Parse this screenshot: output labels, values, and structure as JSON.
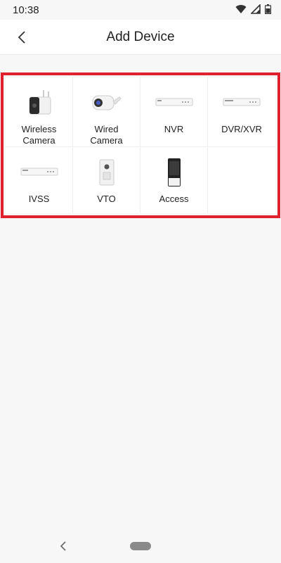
{
  "status_bar": {
    "time": "10:38",
    "icons": [
      "wifi-icon",
      "signal-icon",
      "battery-icon"
    ]
  },
  "header": {
    "title": "Add Device",
    "back_icon": "back-arrow-icon"
  },
  "device_grid": {
    "items": [
      {
        "label": "Wireless Camera",
        "icon": "wireless-camera-icon"
      },
      {
        "label": "Wired Camera",
        "icon": "wired-camera-icon"
      },
      {
        "label": "NVR",
        "icon": "nvr-icon"
      },
      {
        "label": "DVR/XVR",
        "icon": "dvr-icon"
      },
      {
        "label": "IVSS",
        "icon": "ivss-icon"
      },
      {
        "label": "VTO",
        "icon": "vto-icon"
      },
      {
        "label": "Access",
        "icon": "access-icon"
      }
    ]
  },
  "colors": {
    "highlight": "#e0202c",
    "background": "#f7f7f7",
    "tile_background": "#ffffff"
  },
  "nav_bar": {
    "back_icon": "nav-back-icon",
    "home_icon": "nav-home-pill"
  }
}
